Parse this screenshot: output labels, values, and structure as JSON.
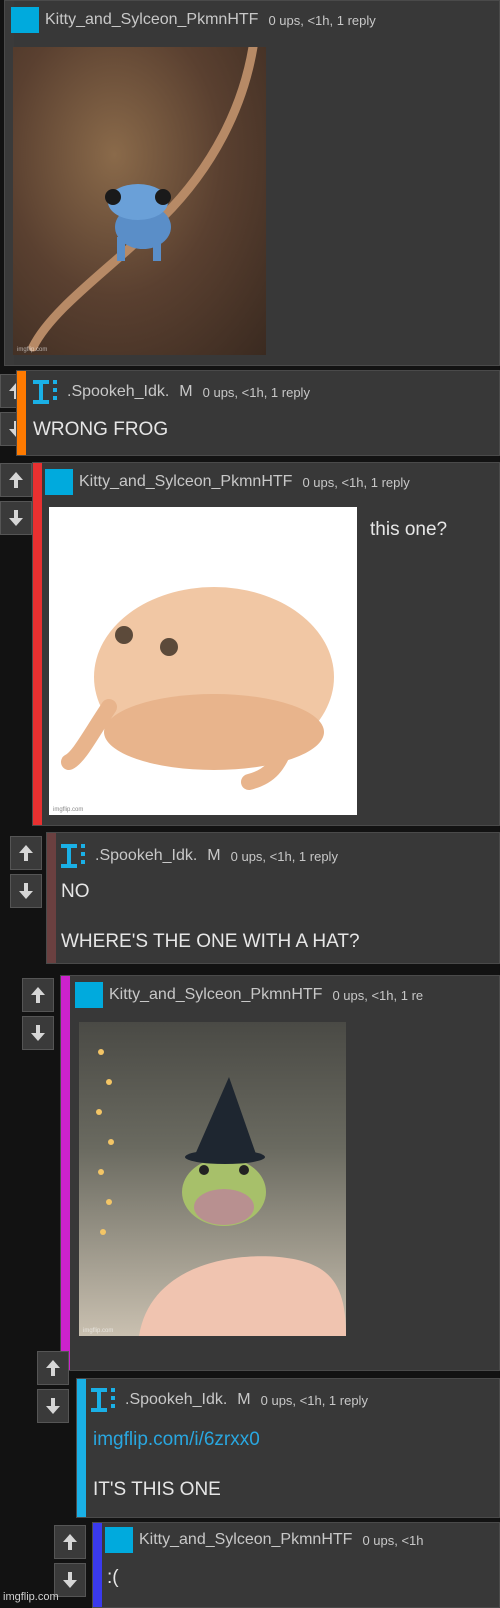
{
  "comments": [
    {
      "user": "Kitty_and_Sylceon_PkmnHTF",
      "meta": "0 ups, <1h, 1 reply",
      "bar_color": "#333333"
    },
    {
      "user": ".Spookeh_Idk.",
      "mod": "M",
      "meta": "0 ups, <1h, 1 reply",
      "text": "WRONG FROG",
      "bar_color": "#ff7a00"
    },
    {
      "user": "Kitty_and_Sylceon_PkmnHTF",
      "meta": "0 ups, <1h, 1 reply",
      "text": "this one?",
      "bar_color": "#e83030"
    },
    {
      "user": ".Spookeh_Idk.",
      "mod": "M",
      "meta": "0 ups, <1h, 1 reply",
      "line1": "NO",
      "line2": "WHERE'S THE ONE WITH A HAT?",
      "bar_color": "#6a4040"
    },
    {
      "user": "Kitty_and_Sylceon_PkmnHTF",
      "meta": "0 ups, <1h, 1 re",
      "bar_color": "#cc22cc"
    },
    {
      "user": ".Spookeh_Idk.",
      "mod": "M",
      "meta": "0 ups, <1h, 1 reply",
      "link": "imgflip.com/i/6zrxx0",
      "text": "IT'S THIS ONE",
      "bar_color": "#1ab0e6"
    },
    {
      "user": "Kitty_and_Sylceon_PkmnHTF",
      "meta": "0 ups, <1h",
      "text": ":(",
      "bar_color": "#3a3aee"
    }
  ],
  "images": {
    "watermark": "imgflip.com"
  },
  "footer": {
    "watermark": "imgflip.com"
  },
  "icons": {
    "upvote": "arrow-up-icon",
    "downvote": "arrow-down-icon",
    "avatar": "user-avatar",
    "spookeh_avatar": "ti-logo-icon"
  }
}
